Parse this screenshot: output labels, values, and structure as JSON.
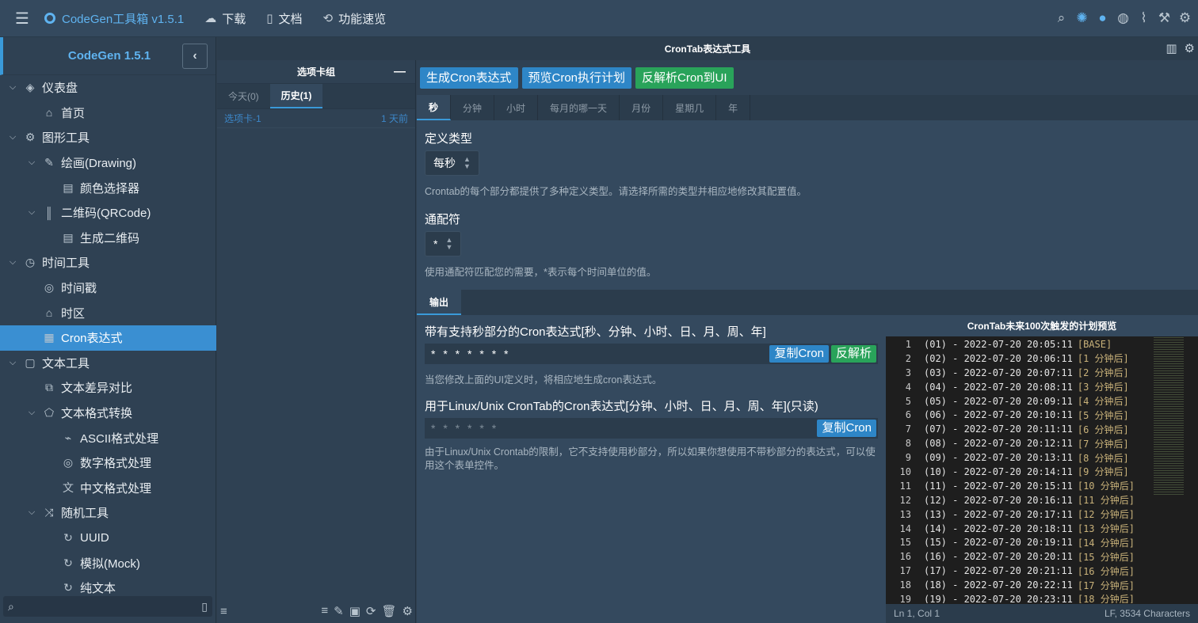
{
  "header": {
    "app_title": "CodeGen工具箱 v1.5.1",
    "nav": [
      {
        "label": "下载",
        "icon": "cloud-download-icon"
      },
      {
        "label": "文档",
        "icon": "book-icon"
      },
      {
        "label": "功能速览",
        "icon": "overview-icon"
      }
    ],
    "right_icons": [
      "search-icon",
      "sun-icon",
      "user-icon",
      "globe-icon",
      "paperclip-icon",
      "wrench-icon",
      "gear-icon"
    ]
  },
  "sidebar": {
    "title": "CodeGen 1.5.1",
    "items": [
      {
        "label": "仪表盘",
        "icon": "layers-icon",
        "level": 0,
        "expanded": true
      },
      {
        "label": "首页",
        "icon": "home-icon",
        "level": 1
      },
      {
        "label": "图形工具",
        "icon": "gear-icon",
        "level": 0,
        "expanded": true
      },
      {
        "label": "绘画(Drawing)",
        "icon": "pen-icon",
        "level": 1,
        "expanded": true
      },
      {
        "label": "颜色选择器",
        "icon": "window-icon",
        "level": 2
      },
      {
        "label": "二维码(QRCode)",
        "icon": "barcode-icon",
        "level": 1,
        "expanded": true
      },
      {
        "label": "生成二维码",
        "icon": "window-icon",
        "level": 2
      },
      {
        "label": "时间工具",
        "icon": "clock-icon",
        "level": 0,
        "expanded": true
      },
      {
        "label": "时间戳",
        "icon": "timestamp-icon",
        "level": 1
      },
      {
        "label": "时区",
        "icon": "timezone-icon",
        "level": 1
      },
      {
        "label": "Cron表达式",
        "icon": "calendar-icon",
        "level": 1,
        "selected": true
      },
      {
        "label": "文本工具",
        "icon": "text-tool-icon",
        "level": 0,
        "expanded": true
      },
      {
        "label": "文本差异对比",
        "icon": "diff-icon",
        "level": 1
      },
      {
        "label": "文本格式转换",
        "icon": "convert-icon",
        "level": 1,
        "expanded": true
      },
      {
        "label": "ASCII格式处理",
        "icon": "ascii-icon",
        "level": 2
      },
      {
        "label": "数字格式处理",
        "icon": "number-icon",
        "level": 2
      },
      {
        "label": "中文格式处理",
        "icon": "translate-icon",
        "level": 2
      },
      {
        "label": "随机工具",
        "icon": "shuffle-icon",
        "level": 1,
        "expanded": true
      },
      {
        "label": "UUID",
        "icon": "refresh-icon",
        "level": 2
      },
      {
        "label": "模拟(Mock)",
        "icon": "refresh-icon",
        "level": 2
      },
      {
        "label": "纯文本",
        "icon": "refresh-icon",
        "level": 2
      }
    ]
  },
  "tab_panel": {
    "title": "选项卡组",
    "tabs": [
      "今天(0)",
      "历史(1)"
    ],
    "active_tab": 1,
    "rows": [
      {
        "name": "选项卡-1",
        "time": "1 天前"
      }
    ]
  },
  "tool": {
    "title": "CronTab表达式工具",
    "actions": [
      "生成Cron表达式",
      "预览Cron执行计划",
      "反解析Cron到UI"
    ],
    "field_tabs": [
      "秒",
      "分钟",
      "小时",
      "每月的哪一天",
      "月份",
      "星期几",
      "年"
    ],
    "active_field_tab": 0,
    "def_type_label": "定义类型",
    "def_type_value": "每秒",
    "def_type_help": "Crontab的每个部分都提供了多种定义类型。请选择所需的类型并相应地修改其配置值。",
    "wildcard_label": "通配符",
    "wildcard_value": "*",
    "wildcard_help": "使用通配符匹配您的需要，*表示每个时间单位的值。"
  },
  "output": {
    "tab": "输出",
    "expr1_label": "带有支持秒部分的Cron表达式[秒、分钟、小时、日、月、周、年]",
    "expr1_value": "* * * * * * *",
    "expr1_copy": "复制Cron",
    "expr1_parse": "反解析",
    "expr1_help": "当您修改上面的UI定义时，将相应地生成cron表达式。",
    "expr2_label": "用于Linux/Unix CronTab的Cron表达式[分钟、小时、日、月、周、年](只读)",
    "expr2_value": "* * * * * *",
    "expr2_copy": "复制Cron",
    "expr2_help": "由于Linux/Unix Crontab的限制，它不支持使用秒部分，所以如果你想使用不带秒部分的表达式，可以使用这个表单控件。"
  },
  "preview": {
    "title": "CronTab未来100次触发的计划预览",
    "lines": [
      {
        "n": "1",
        "t": "(01) - 2022-07-20 20:05:11",
        "m": "[BASE]"
      },
      {
        "n": "2",
        "t": "(02) - 2022-07-20 20:06:11",
        "m": "[1 分钟后]"
      },
      {
        "n": "3",
        "t": "(03) - 2022-07-20 20:07:11",
        "m": "[2 分钟后]"
      },
      {
        "n": "4",
        "t": "(04) - 2022-07-20 20:08:11",
        "m": "[3 分钟后]"
      },
      {
        "n": "5",
        "t": "(05) - 2022-07-20 20:09:11",
        "m": "[4 分钟后]"
      },
      {
        "n": "6",
        "t": "(06) - 2022-07-20 20:10:11",
        "m": "[5 分钟后]"
      },
      {
        "n": "7",
        "t": "(07) - 2022-07-20 20:11:11",
        "m": "[6 分钟后]"
      },
      {
        "n": "8",
        "t": "(08) - 2022-07-20 20:12:11",
        "m": "[7 分钟后]"
      },
      {
        "n": "9",
        "t": "(09) - 2022-07-20 20:13:11",
        "m": "[8 分钟后]"
      },
      {
        "n": "10",
        "t": "(10) - 2022-07-20 20:14:11",
        "m": "[9 分钟后]"
      },
      {
        "n": "11",
        "t": "(11) - 2022-07-20 20:15:11",
        "m": "[10 分钟后]"
      },
      {
        "n": "12",
        "t": "(12) - 2022-07-20 20:16:11",
        "m": "[11 分钟后]"
      },
      {
        "n": "13",
        "t": "(13) - 2022-07-20 20:17:11",
        "m": "[12 分钟后]"
      },
      {
        "n": "14",
        "t": "(14) - 2022-07-20 20:18:11",
        "m": "[13 分钟后]"
      },
      {
        "n": "15",
        "t": "(15) - 2022-07-20 20:19:11",
        "m": "[14 分钟后]"
      },
      {
        "n": "16",
        "t": "(16) - 2022-07-20 20:20:11",
        "m": "[15 分钟后]"
      },
      {
        "n": "17",
        "t": "(17) - 2022-07-20 20:21:11",
        "m": "[16 分钟后]"
      },
      {
        "n": "18",
        "t": "(18) - 2022-07-20 20:22:11",
        "m": "[17 分钟后]"
      },
      {
        "n": "19",
        "t": "(19) - 2022-07-20 20:23:11",
        "m": "[18 分钟后]"
      }
    ],
    "status_left": "Ln 1, Col 1",
    "status_right": "LF, 3534 Characters"
  }
}
